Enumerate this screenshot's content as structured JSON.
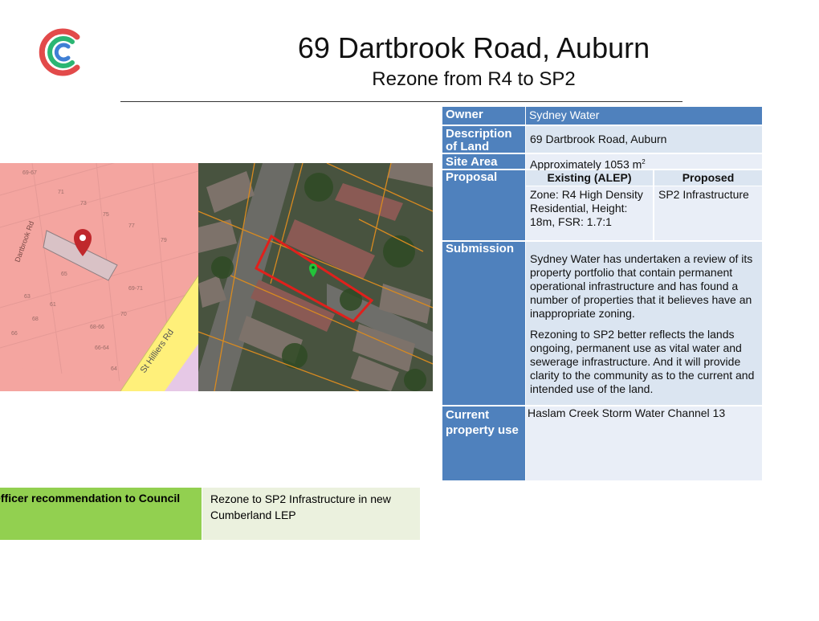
{
  "header": {
    "title": "69 Dartbrook Road, Auburn",
    "subtitle": "Rezone from R4 to SP2"
  },
  "brand": {
    "logo_icon": "cumberland-c-logo-icon",
    "colors": [
      "#e24a4a",
      "#2bb673",
      "#3f7fd4"
    ]
  },
  "zoning_map": {
    "street_label": "Dartbrook Rd",
    "road_label": "St Hilliers Rd",
    "pin_icon": "location-pin-icon",
    "lot_numbers": [
      "69-67",
      "71",
      "73",
      "75",
      "77",
      "79",
      "63",
      "61",
      "65",
      "68",
      "66",
      "70",
      "68-66",
      "69-71",
      "66-64",
      "64"
    ]
  },
  "aerial_map": {
    "pin_icon": "green-pin-icon"
  },
  "table": {
    "owner_label": "Owner",
    "owner_value": "Sydney Water",
    "description_label": "Description of Land",
    "description_value": "69 Dartbrook Road, Auburn",
    "site_area_label": "Site Area",
    "site_area_value": "Approximately 1053 m",
    "site_area_unit": "2",
    "proposal_label": "Proposal",
    "existing_header": "Existing (ALEP)",
    "proposed_header": "Proposed",
    "existing_value": "Zone: R4 High Density Residential, Height: 18m, FSR: 1.7:1",
    "proposed_value": "SP2 Infrastructure",
    "submission_label": "Submission",
    "submission_p1": "Sydney Water has undertaken a review of its property portfolio that contain permanent operational infrastructure and has found a number of properties that it believes have an inappropriate zoning.",
    "submission_p2": "Rezoning to SP2 better reflects the lands ongoing, permanent use as vital water and sewerage infrastructure. And it will provide clarity to the community as to the current and intended use of the land.",
    "current_use_label": "Current property use",
    "current_use_value": "Haslam Creek Storm Water Channel 13"
  },
  "recommendation": {
    "label": "Officer recommendation to Council",
    "value": "Rezone to SP2 Infrastructure in new Cumberland LEP"
  }
}
